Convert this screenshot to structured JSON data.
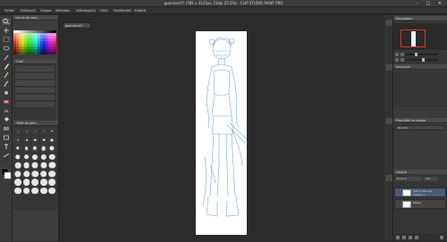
{
  "window": {
    "title": "guerriere1* (782 x 3125px 72dpi 25.5%) - CLIP STUDIO PAINT PRO",
    "minimize_glyph": "–",
    "maximize_glyph": "□",
    "close_glyph": "✕"
  },
  "menu": {
    "items": [
      "Fichier",
      "Edition(E)",
      "Calque",
      "Sélection",
      "Affichage(V)",
      "Filtre",
      "Fenêtre(W)",
      "Aide(H)"
    ]
  },
  "left_panel": {
    "color_header": "Cercle de coul...",
    "subtool_header": "Outil",
    "brush_header": "Taille de pinc..."
  },
  "document": {
    "tab_label": "guerriere1*"
  },
  "right_panel": {
    "navigator_header": "Navigateur",
    "subview_header": "Sous-vue",
    "layer_property_header": "Propriété du calque",
    "layer_property_value": "Normal",
    "layers_header": "Calque",
    "blend_mode": "Normal",
    "opacity": "100",
    "layers": [
      {
        "name": "100 % Normal",
        "sub": "Calque 1"
      },
      {
        "name": "Papier",
        "sub": ""
      }
    ]
  },
  "colors": {
    "accent_red": "#e03030",
    "sketch_blue": "#7aa6d6",
    "main_fg": "#000000",
    "main_bg": "#ffffff"
  }
}
